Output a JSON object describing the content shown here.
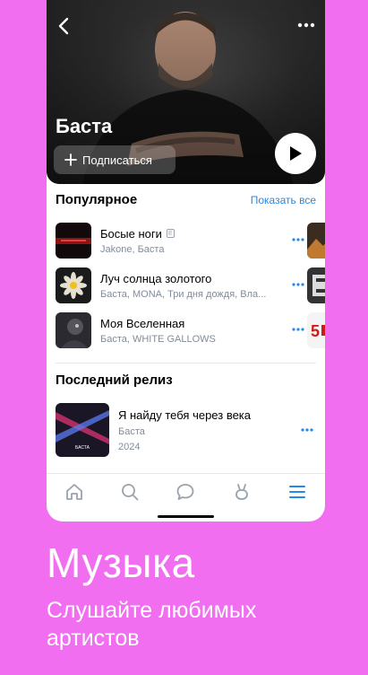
{
  "artist": {
    "name": "Баста",
    "subscribe_label": "Подписаться"
  },
  "popular": {
    "title": "Популярное",
    "show_all": "Показать все",
    "tracks": [
      {
        "title": "Босые ноги",
        "artist": "Jakone, Баста",
        "explicit": true
      },
      {
        "title": "Луч солнца золотого",
        "artist": "Баста, MONA, Три дня дождя, Вла...",
        "explicit": false
      },
      {
        "title": "Моя Вселенная",
        "artist": "Баста, WHITE GALLOWS",
        "explicit": false
      }
    ]
  },
  "latest_release": {
    "title": "Последний релиз",
    "name": "Я найду тебя через века",
    "artist": "Баста",
    "year": "2024",
    "cover_text": "БАСТА"
  },
  "explicit_mark": "E",
  "tabs": [
    "home-icon",
    "search-icon",
    "messages-icon",
    "clips-icon",
    "menu-icon"
  ],
  "promo": {
    "title": "Музыка",
    "subtitle": "Слушайте любимых артистов"
  },
  "colors": {
    "background": "#f26ef0",
    "accent": "#2688eb"
  }
}
